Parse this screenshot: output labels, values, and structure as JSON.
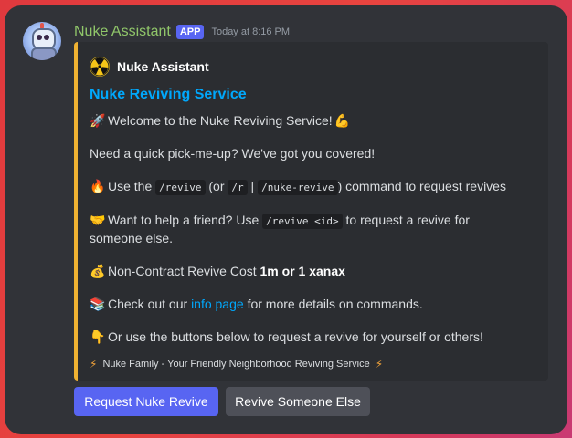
{
  "message": {
    "author": "Nuke Assistant",
    "badge": "APP",
    "timestamp": "Today at 8:16 PM"
  },
  "embed": {
    "accent_color": "#f0b232",
    "author_name": "Nuke Assistant",
    "author_icon": "radioactive-icon",
    "title": "Nuke Reviving Service",
    "lines": {
      "welcome": "Welcome to the Nuke Reviving Service!",
      "pickup": "Need a quick pick-me-up? We've got you covered!",
      "use_prefix": "Use the",
      "cmd_revive": "/revive",
      "use_or": "(or",
      "cmd_r": "/r",
      "use_pipe": "|",
      "cmd_nuke_revive": "/nuke-revive",
      "use_suffix": ") command to request revives",
      "help_prefix": "Want to help a friend? Use",
      "cmd_revive_id": "/revive <id>",
      "help_suffix": "to request a revive for someone else.",
      "cost_prefix": "Non-Contract Revive Cost",
      "cost_value": "1m or 1 xanax",
      "info_prefix": "Check out our",
      "info_link": "info page",
      "info_suffix": "for more details on commands.",
      "buttons_hint": "Or use the buttons below to request a revive for yourself or others!"
    },
    "footer": "Nuke Family - Your Friendly Neighborhood Reviving Service"
  },
  "buttons": {
    "primary": "Request Nuke Revive",
    "secondary": "Revive Someone Else"
  },
  "icons": {
    "rocket": "rocket-icon",
    "muscle": "flexed-biceps-icon",
    "fire": "fire-icon",
    "handshake": "handshake-icon",
    "money": "money-bag-icon",
    "books": "books-icon",
    "point": "pointing-down-icon",
    "lightning": "lightning-icon"
  },
  "colors": {
    "author": "#90c66a",
    "link": "#00a8fc",
    "primary_button": "#5865f2",
    "secondary_button": "#4e5058"
  }
}
